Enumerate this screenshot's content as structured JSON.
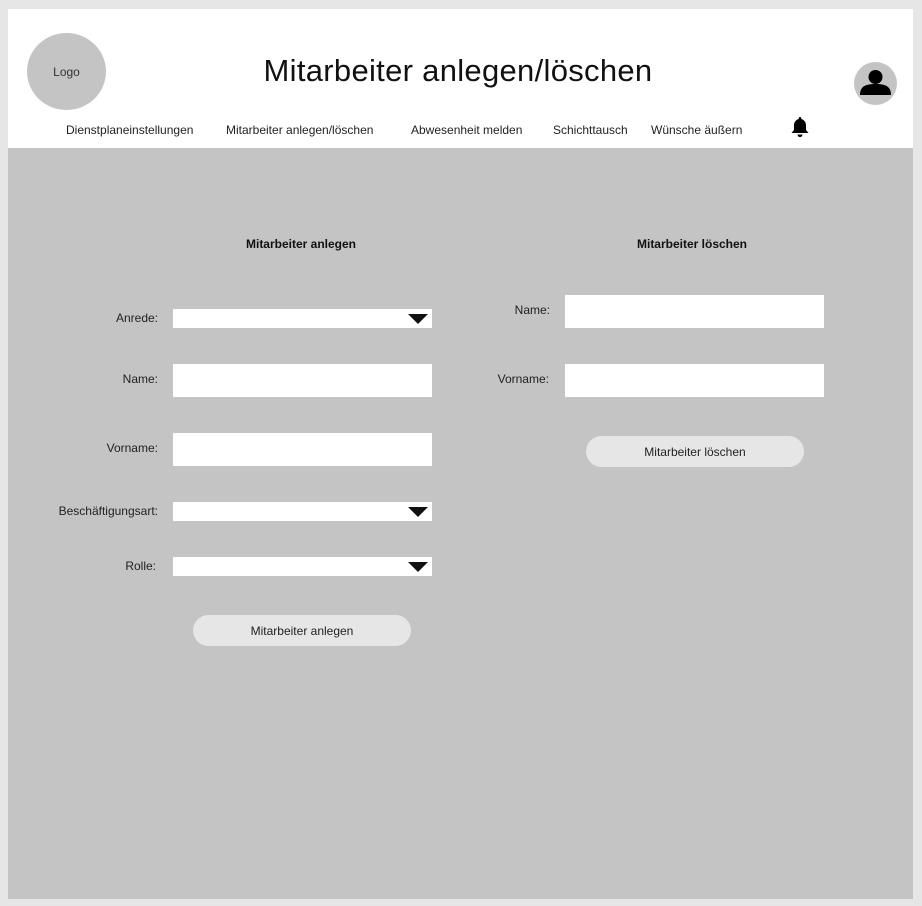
{
  "header": {
    "logo_text": "Logo",
    "title": "Mitarbeiter anlegen/löschen",
    "avatar_icon": "user-icon",
    "bell_icon": "bell-icon"
  },
  "nav": {
    "items": [
      "Dienstplaneinstellungen",
      "Mitarbeiter anlegen/löschen",
      "Abwesenheit melden",
      "Schichttausch",
      "Wünsche äußern"
    ]
  },
  "create": {
    "title": "Mitarbeiter anlegen",
    "anrede_label": "Anrede:",
    "anrede_value": "",
    "name_label": "Name:",
    "name_value": "",
    "vorname_label": "Vorname:",
    "vorname_value": "",
    "beschaeftigung_label": "Beschäftigungsart:",
    "beschaeftigung_value": "",
    "rolle_label": "Rolle:",
    "rolle_value": "",
    "button_label": "Mitarbeiter anlegen"
  },
  "delete": {
    "title": "Mitarbeiter löschen",
    "name_label": "Name:",
    "name_value": "",
    "vorname_label": "Vorname:",
    "vorname_value": "",
    "button_label": "Mitarbeiter löschen"
  },
  "colors": {
    "background": "#c4c4c4",
    "header": "#ffffff",
    "button": "#e6e6e6"
  }
}
